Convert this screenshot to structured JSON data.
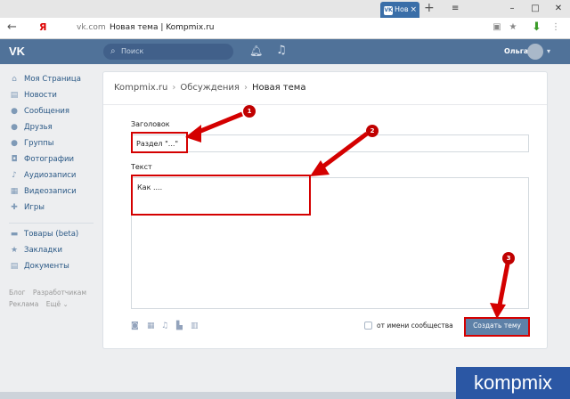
{
  "browser": {
    "tab_label": "Нов",
    "url_domain": "vk.com",
    "page_title": "Новая тема | Kompmix.ru",
    "ya_label": "Я"
  },
  "header": {
    "logo": "VK",
    "search_placeholder": "Поиск",
    "username": "Ольга"
  },
  "sidebar": {
    "items": [
      {
        "label": "Моя Страница",
        "icon": "home-icon"
      },
      {
        "label": "Новости",
        "icon": "news-icon"
      },
      {
        "label": "Сообщения",
        "icon": "messages-icon"
      },
      {
        "label": "Друзья",
        "icon": "friends-icon"
      },
      {
        "label": "Группы",
        "icon": "groups-icon"
      },
      {
        "label": "Фотографии",
        "icon": "photos-icon"
      },
      {
        "label": "Аудиозаписи",
        "icon": "audio-icon"
      },
      {
        "label": "Видеозаписи",
        "icon": "video-icon"
      },
      {
        "label": "Игры",
        "icon": "games-icon"
      }
    ],
    "items2": [
      {
        "label": "Товары (beta)",
        "icon": "goods-icon"
      },
      {
        "label": "Закладки",
        "icon": "bookmarks-icon"
      },
      {
        "label": "Документы",
        "icon": "documents-icon"
      }
    ],
    "footer": {
      "blog": "Блог",
      "devs": "Разработчикам",
      "ads": "Реклама",
      "more": "Ещё"
    }
  },
  "main": {
    "breadcrumbs": [
      "Kompmix.ru",
      "Обсуждения",
      "Новая тема"
    ],
    "title_label": "Заголовок",
    "title_value": "Раздел \"...\"",
    "text_label": "Текст",
    "text_value": "Как ....",
    "community_label": "от имени сообщества",
    "submit_label": "Создать тему"
  },
  "annotations": {
    "badges": [
      "1",
      "2",
      "3"
    ],
    "color": "#d40000"
  },
  "watermark": "kompmix",
  "colors": {
    "vk_header": "#507299",
    "link": "#2a5885",
    "button": "#5e81a8"
  }
}
